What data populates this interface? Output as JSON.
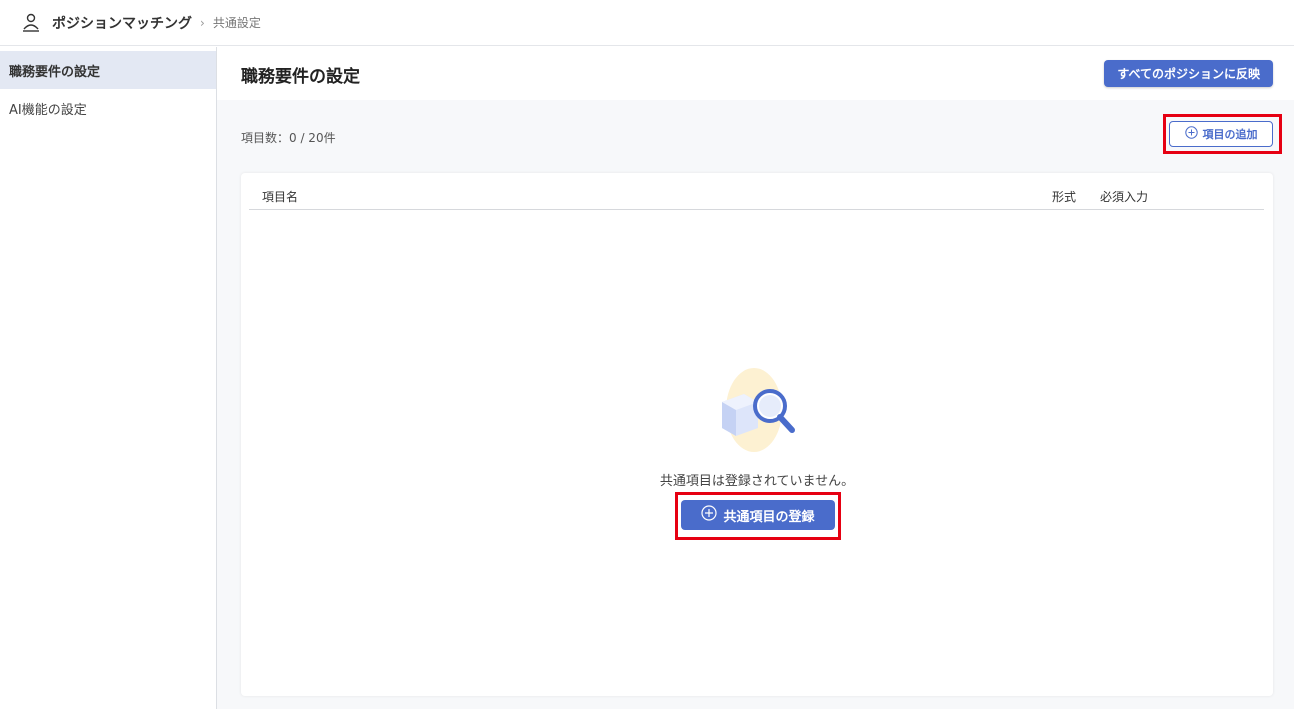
{
  "header": {
    "app_title": "ポジションマッチング",
    "breadcrumb_current": "共通設定",
    "separator": "›"
  },
  "sidebar": {
    "items": [
      {
        "label": "職務要件の設定",
        "active": true
      },
      {
        "label": "AI機能の設定",
        "active": false
      }
    ]
  },
  "main": {
    "page_title": "職務要件の設定",
    "apply_all_button": "すべてのポジションに反映",
    "item_count": "項目数：0 / 20件",
    "add_item_button": "項目の追加",
    "table": {
      "columns": [
        "項目名",
        "形式",
        "必須入力"
      ]
    },
    "empty_message": "共通項目は登録されていません。",
    "register_button": "共通項目の登録"
  },
  "colors": {
    "primary": "#4a6ccb",
    "highlight": "#e60012",
    "sidebar_active": "#e3e8f3"
  }
}
